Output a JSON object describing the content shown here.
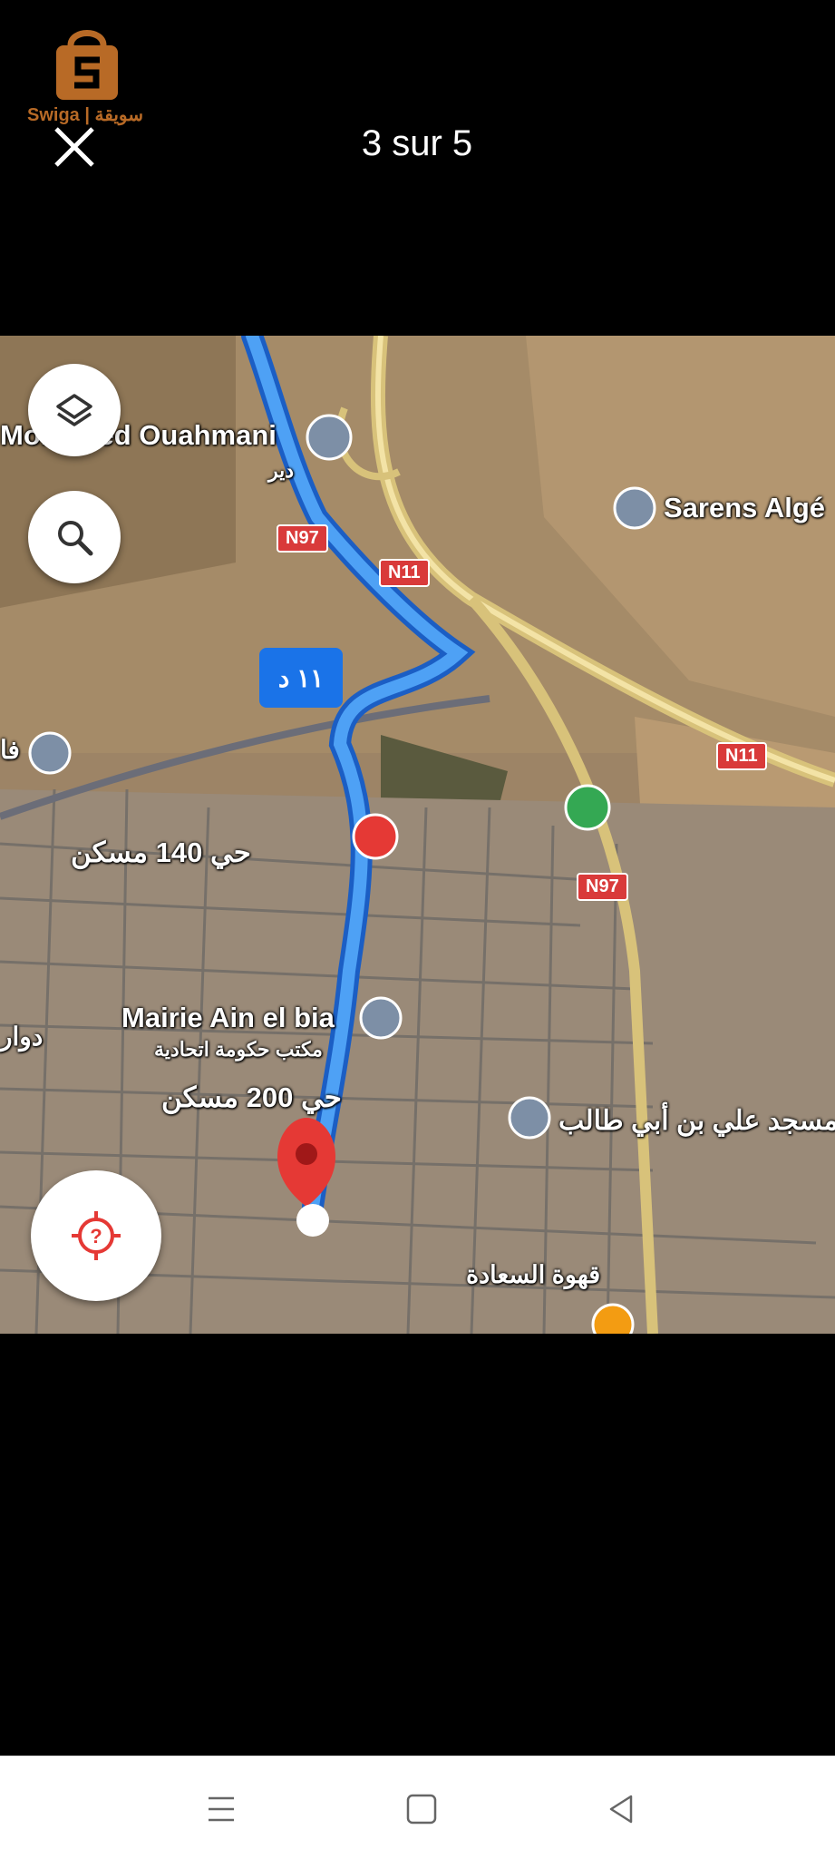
{
  "header": {
    "logo_text": "Swiga | سويقة",
    "counter": "3 sur 5",
    "close_icon": "close-icon"
  },
  "map": {
    "route_time": "١١ د",
    "labels": {
      "mohamed": "Mohamed Ouahmani",
      "dir": "دير",
      "sarens": "Sarens Algé",
      "hay140": "حي 140 مسكن",
      "mairie": "Mairie Ain el bia",
      "maktab": "مكتب حكومة اتحادية",
      "hay200": "حي 200 مسكن",
      "masjid": "مسجد علي بن أبي طالب",
      "qahwa": "قهوة السعادة",
      "douar": "دوار",
      "fa": "فا"
    },
    "roads": {
      "n97_a": "N97",
      "n11_a": "N11",
      "n11_b": "N11",
      "n97_b": "N97"
    },
    "icons": {
      "layers": "layers-icon",
      "search": "search-icon",
      "locate": "my-location-icon"
    }
  },
  "navbar": {
    "menu": "menu-icon",
    "home": "home-icon",
    "back": "back-icon"
  }
}
